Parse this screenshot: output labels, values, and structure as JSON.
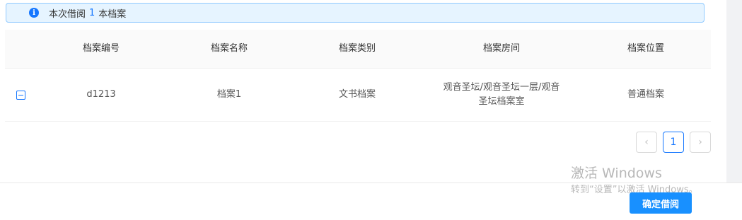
{
  "alert": {
    "prefix": "本次借阅",
    "count": "1",
    "suffix": "本档案",
    "icon": "info-icon"
  },
  "table": {
    "headers": [
      "档案编号",
      "档案名称",
      "档案类别",
      "档案房间",
      "档案位置"
    ],
    "rows": [
      {
        "code": "d1213",
        "name": "档案1",
        "category": "文书档案",
        "room": "观音圣坛/观音圣坛一层/观音圣坛档案室",
        "location": "普通档案"
      }
    ]
  },
  "pagination": {
    "prev": "‹",
    "current": "1",
    "next": "›"
  },
  "footer": {
    "confirm_label": "确定借阅"
  },
  "watermark": {
    "title": "激活 Windows",
    "subtitle": "转到“设置”以激活 Windows。"
  },
  "colors": {
    "primary": "#1677ff",
    "button": "#1890ff",
    "alert_bg": "#e6f4ff",
    "alert_border": "#91caff"
  }
}
